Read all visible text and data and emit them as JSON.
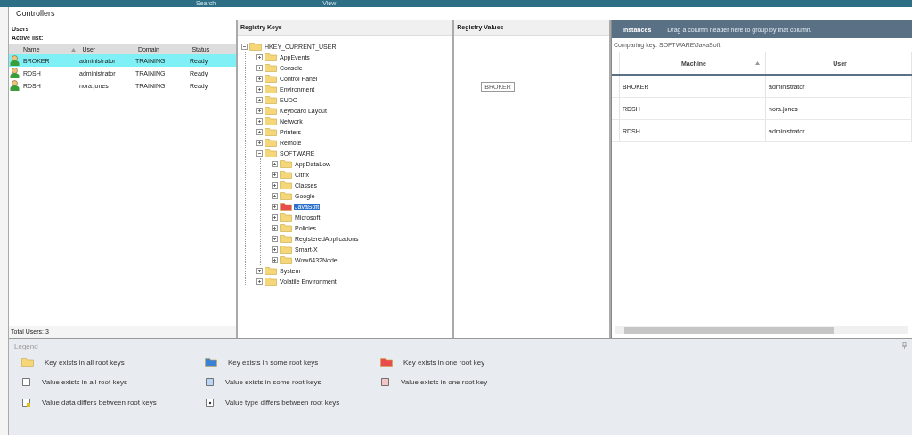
{
  "top_bar": {
    "items": [
      "Search",
      "View"
    ]
  },
  "tab": {
    "label": "Controllers"
  },
  "users": {
    "title": "Users",
    "subtitle": "Active list:",
    "columns": [
      "Name",
      "User",
      "Domain",
      "Status"
    ],
    "rows": [
      {
        "name": "BROKER",
        "user": "administrator",
        "domain": "TRAINING",
        "status": "Ready",
        "selected": true
      },
      {
        "name": "RDSH",
        "user": "administrator",
        "domain": "TRAINING",
        "status": "Ready",
        "selected": false
      },
      {
        "name": "RDSH",
        "user": "nora.jones",
        "domain": "TRAINING",
        "status": "Ready",
        "selected": false
      }
    ],
    "footer": "Total Users: 3"
  },
  "registry_keys": {
    "title": "Registry Keys",
    "tree": [
      {
        "label": "HKEY_CURRENT_USER",
        "expanded": true,
        "selected": false,
        "color": "#f5d77a",
        "children": [
          {
            "label": "AppEvents",
            "expanded": false,
            "selected": false,
            "color": "#f5d77a"
          },
          {
            "label": "Console",
            "expanded": false,
            "selected": false,
            "color": "#f5d77a"
          },
          {
            "label": "Control Panel",
            "expanded": false,
            "selected": false,
            "color": "#f5d77a"
          },
          {
            "label": "Environment",
            "expanded": false,
            "selected": false,
            "color": "#f5d77a"
          },
          {
            "label": "EUDC",
            "expanded": false,
            "selected": false,
            "color": "#f5d77a"
          },
          {
            "label": "Keyboard Layout",
            "expanded": false,
            "selected": false,
            "color": "#f5d77a"
          },
          {
            "label": "Network",
            "expanded": false,
            "selected": false,
            "color": "#f5d77a"
          },
          {
            "label": "Printers",
            "expanded": false,
            "selected": false,
            "color": "#f5d77a"
          },
          {
            "label": "Remote",
            "expanded": false,
            "selected": false,
            "color": "#f5d77a"
          },
          {
            "label": "SOFTWARE",
            "expanded": true,
            "selected": false,
            "color": "#f5d77a",
            "children": [
              {
                "label": "AppDataLow",
                "expanded": false,
                "selected": false,
                "color": "#f5d77a"
              },
              {
                "label": "Citrix",
                "expanded": false,
                "selected": false,
                "color": "#f5d77a"
              },
              {
                "label": "Classes",
                "expanded": false,
                "selected": false,
                "color": "#f5d77a"
              },
              {
                "label": "Google",
                "expanded": false,
                "selected": false,
                "color": "#f5d77a"
              },
              {
                "label": "JavaSoft",
                "expanded": false,
                "selected": true,
                "color": "#e84c4c"
              },
              {
                "label": "Microsoft",
                "expanded": false,
                "selected": false,
                "color": "#f5d77a"
              },
              {
                "label": "Policies",
                "expanded": false,
                "selected": false,
                "color": "#f5d77a"
              },
              {
                "label": "RegisteredApplications",
                "expanded": false,
                "selected": false,
                "color": "#f5d77a"
              },
              {
                "label": "Smart-X",
                "expanded": false,
                "selected": false,
                "color": "#f5d77a"
              },
              {
                "label": "Wow6432Node",
                "expanded": false,
                "selected": false,
                "color": "#f5d77a"
              }
            ]
          },
          {
            "label": "System",
            "expanded": false,
            "selected": false,
            "color": "#f5d77a"
          },
          {
            "label": "Volatile Environment",
            "expanded": false,
            "selected": false,
            "color": "#f5d77a"
          }
        ]
      }
    ]
  },
  "registry_values": {
    "title": "Registry Values",
    "tag": "BROKER"
  },
  "instances": {
    "title": "Instances",
    "group_hint": "Drag a column header here to group by that column.",
    "comparing": "Comparing key: SOFTWARE\\JavaSoft",
    "columns": [
      "Machine",
      "User"
    ],
    "rows": [
      {
        "machine": "BROKER",
        "user": "administrator"
      },
      {
        "machine": "RDSH",
        "user": "nora.jones"
      },
      {
        "machine": "RDSH",
        "user": "administrator"
      }
    ]
  },
  "legend": {
    "title": "Legend",
    "items": [
      {
        "kind": "folder",
        "color": "#f5d77a",
        "label": "Key exists in all root keys"
      },
      {
        "kind": "folder",
        "color": "#3b82d6",
        "label": "Key exists in some root keys"
      },
      {
        "kind": "folder",
        "color": "#e84c4c",
        "label": "Key exists in one root key"
      },
      {
        "kind": "value",
        "color": "#ffffff",
        "label": "Value exists in all root keys"
      },
      {
        "kind": "value",
        "color": "#bcd6f5",
        "label": "Value exists in some root keys"
      },
      {
        "kind": "value",
        "color": "#f5c4c4",
        "label": "Value exists in one root key"
      },
      {
        "kind": "data",
        "color": "#ffffff",
        "label": "Value data differs between root keys"
      },
      {
        "kind": "type",
        "color": "#ffffff",
        "label": "Value type differs between root keys"
      }
    ]
  }
}
